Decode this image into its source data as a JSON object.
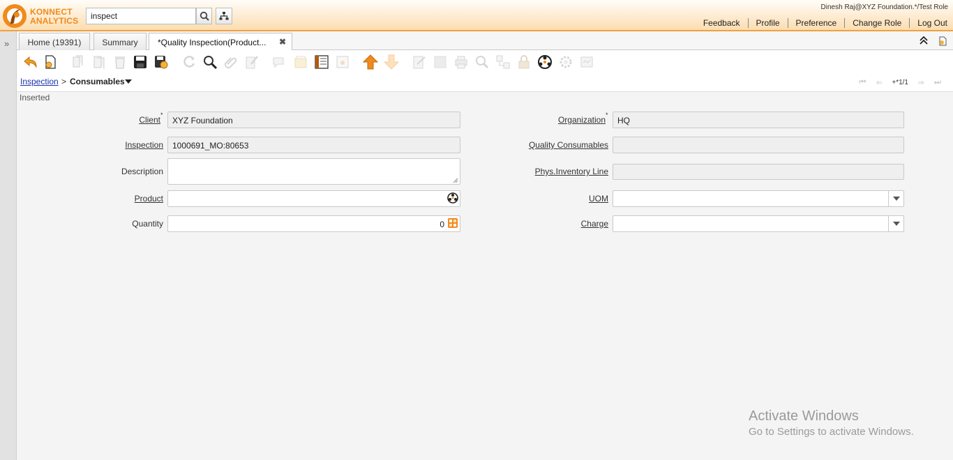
{
  "app": {
    "logo_line1": "KONNECT",
    "logo_line2": "ANALYTICS",
    "search_value": "inspect",
    "user": "Dinesh Raj@XYZ Foundation.*/Test Role",
    "links": [
      "Feedback",
      "Profile",
      "Preference",
      "Change Role",
      "Log Out"
    ],
    "accent": "#f08a1c"
  },
  "tabs": [
    {
      "label": "Home (19391)"
    },
    {
      "label": "Summary"
    },
    {
      "label": "*Quality Inspection(Product..."
    }
  ],
  "toolbar_icons": [
    "undo-icon",
    "new-icon",
    "copy-icon",
    "copy-details-icon",
    "delete-icon",
    "save-icon",
    "save-new-icon",
    "refresh-icon",
    "find-icon",
    "attachment-icon",
    "note-icon",
    "chat-icon",
    "history-icon",
    "grid-toggle-icon",
    "parent-record-icon",
    "up-icon",
    "down-icon",
    "report-icon",
    "archive-icon",
    "print-icon",
    "zoom-across-icon",
    "related-icon",
    "lock-icon",
    "workflow-icon",
    "process-icon",
    "customize-icon"
  ],
  "breadcrumb": {
    "parent": "Inspection",
    "separator": ">",
    "current": "Consumables",
    "record": "+*1/1"
  },
  "status": "Inserted",
  "form": {
    "client_label": "Client",
    "client_value": "XYZ Foundation",
    "organization_label": "Organization",
    "organization_value": "HQ",
    "inspection_label": "Inspection",
    "inspection_value": "1000691_MO:80653",
    "quality_consumables_label": "Quality Consumables",
    "quality_consumables_value": "",
    "description_label": "Description",
    "description_value": "",
    "phys_inventory_label": "Phys.Inventory Line",
    "phys_inventory_value": "",
    "product_label": "Product",
    "product_value": "",
    "uom_label": "UOM",
    "uom_value": "",
    "quantity_label": "Quantity",
    "quantity_value": "0",
    "charge_label": "Charge",
    "charge_value": "",
    "required_mark": "*"
  },
  "watermark": {
    "line1": "Activate Windows",
    "line2": "Go to Settings to activate Windows."
  }
}
